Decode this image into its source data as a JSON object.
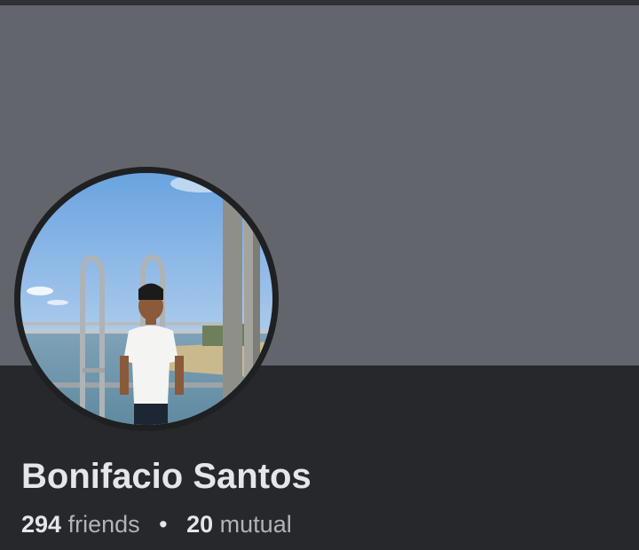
{
  "profile": {
    "name": "Bonifacio Santos",
    "friends_count": "294",
    "friends_label": "friends",
    "separator": "•",
    "mutual_count": "20",
    "mutual_label": "mutual"
  },
  "colors": {
    "cover": "#62666c",
    "info_background": "#26282b",
    "name_text": "#e4e6eb",
    "secondary_text": "#b0b3b8"
  },
  "icons": [
    "profile-photo"
  ]
}
